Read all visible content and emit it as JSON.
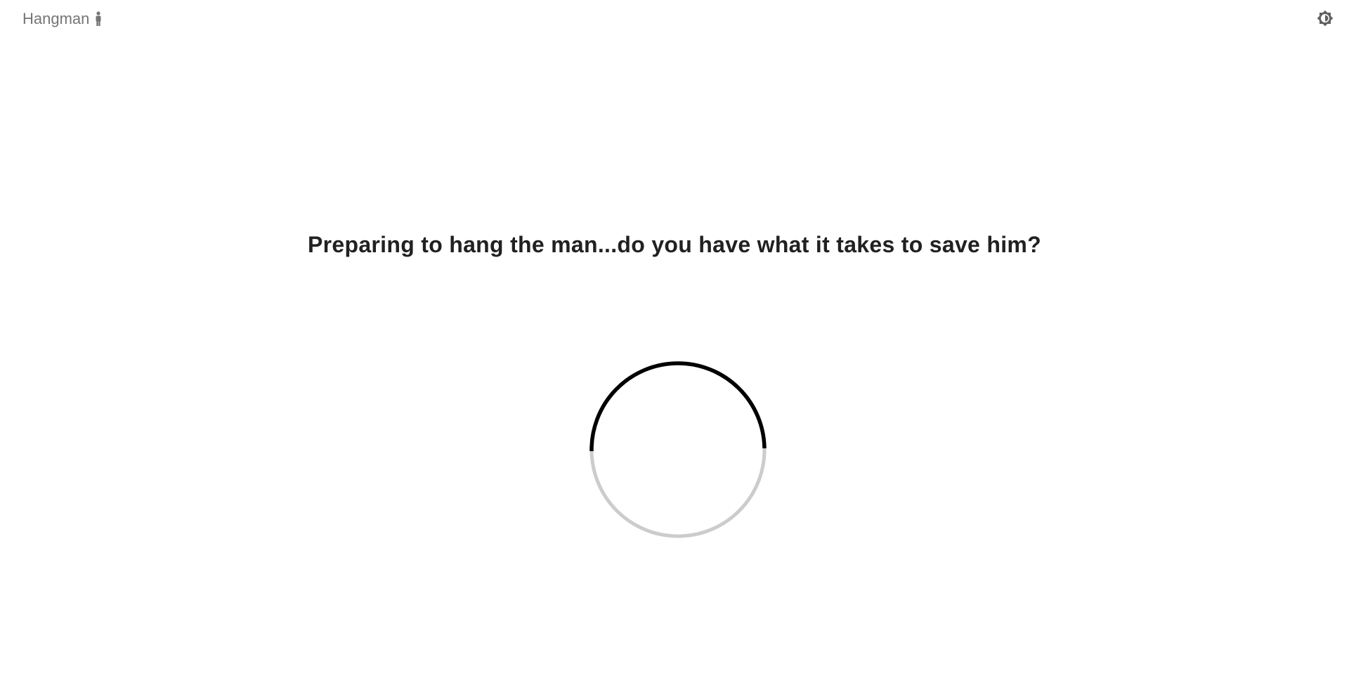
{
  "header": {
    "brand_label": "Hangman",
    "brand_icon": "person-standing-icon",
    "theme_toggle_icon": "brightness-icon"
  },
  "main": {
    "loading_message": "Preparing to hang the man...do you have what it takes to save him?",
    "spinner": {
      "progress_fraction": 0.5,
      "track_color": "#cccccc",
      "progress_color": "#000000"
    }
  },
  "colors": {
    "brand_text": "#757575",
    "message_text": "#212121",
    "background": "#ffffff"
  }
}
